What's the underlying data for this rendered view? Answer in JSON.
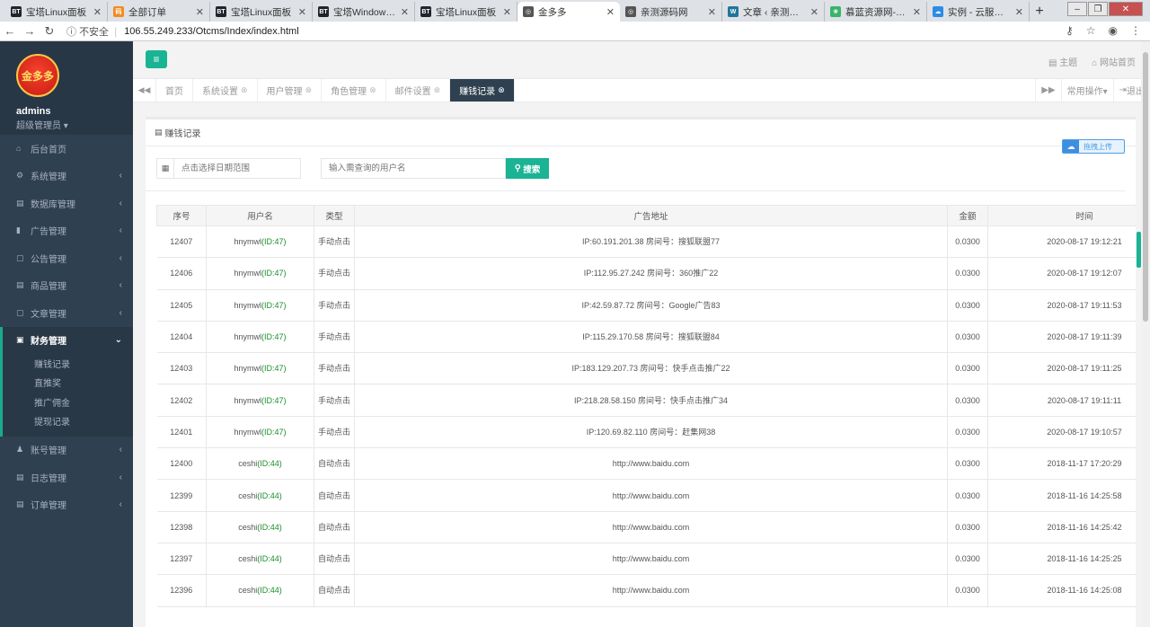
{
  "browser": {
    "tabs": [
      {
        "label": "宝塔Linux面板",
        "fav": "BT",
        "color": "#20242b"
      },
      {
        "label": "全部订单",
        "fav": "码",
        "color": "#f28b21"
      },
      {
        "label": "宝塔Linux面板",
        "fav": "BT",
        "color": "#20242b"
      },
      {
        "label": "宝塔Windows面板",
        "fav": "BT",
        "color": "#20242b"
      },
      {
        "label": "宝塔Linux面板",
        "fav": "BT",
        "color": "#20242b"
      },
      {
        "label": "金多多",
        "fav": "◎",
        "color": "#555555",
        "active": true
      },
      {
        "label": "亲测源码网",
        "fav": "◎",
        "color": "#555555"
      },
      {
        "label": "文章 ‹ 亲测源码网 —",
        "fav": "W",
        "color": "#21759b"
      },
      {
        "label": "慕蓝资源网-源码之家",
        "fav": "❀",
        "color": "#3bb36b"
      },
      {
        "label": "实例 - 云服务器 - 控",
        "fav": "☁",
        "color": "#2c8ce5"
      }
    ],
    "new_tab": "+",
    "security": "不安全",
    "url": "106.55.249.233/Otcms/Index/index.html"
  },
  "sidebar": {
    "logo_text": "金多多",
    "username": "admins",
    "role": "超级管理员 ▾",
    "menu": [
      {
        "label": "后台首页",
        "icon": "⌂",
        "arrow": ""
      },
      {
        "label": "系统管理",
        "icon": "⚙",
        "arrow": "‹"
      },
      {
        "label": "数据库管理",
        "icon": "▤",
        "arrow": "‹"
      },
      {
        "label": "广告管理",
        "icon": "▮",
        "arrow": "‹"
      },
      {
        "label": "公告管理",
        "icon": "▢",
        "arrow": "‹"
      },
      {
        "label": "商品管理",
        "icon": "▤",
        "arrow": "‹"
      },
      {
        "label": "文章管理",
        "icon": "▢",
        "arrow": "‹"
      }
    ],
    "active_menu": {
      "label": "财务管理",
      "icon": "▣",
      "arrow": "⌄"
    },
    "submenu": [
      "赚钱记录",
      "直推奖",
      "推广佣金",
      "提现记录"
    ],
    "menu_after": [
      {
        "label": "账号管理",
        "icon": "♟",
        "arrow": "‹"
      },
      {
        "label": "日志管理",
        "icon": "▤",
        "arrow": "‹"
      },
      {
        "label": "订单管理",
        "icon": "▤",
        "arrow": "‹"
      }
    ]
  },
  "header": {
    "theme": "主题",
    "site_home": "网站首页"
  },
  "page_tabs": {
    "items": [
      {
        "label": "首页",
        "closable": false
      },
      {
        "label": "系统设置",
        "closable": true
      },
      {
        "label": "用户管理",
        "closable": true
      },
      {
        "label": "角色管理",
        "closable": true
      },
      {
        "label": "邮件设置",
        "closable": true
      },
      {
        "label": "赚钱记录",
        "closable": true,
        "active": true
      }
    ],
    "common_ops": "常用操作▾",
    "logout": "退出"
  },
  "card": {
    "title": "赚钱记录",
    "upload_label": "拖拽上传",
    "date_placeholder": "点击选择日期范围",
    "user_placeholder": "输入需查询的用户名",
    "search_label": "搜索"
  },
  "table": {
    "columns": [
      "序号",
      "用户名",
      "类型",
      "广告地址",
      "金额",
      "时间"
    ],
    "rows": [
      {
        "id": "12407",
        "user": "hnymwl",
        "uid": "(ID:47)",
        "type": "手动点击",
        "ad": "IP:60.191.201.38 房间号：搜狐联盟77",
        "amount": "0.0300",
        "time": "2020-08-17 19:12:21"
      },
      {
        "id": "12406",
        "user": "hnymwl",
        "uid": "(ID:47)",
        "type": "手动点击",
        "ad": "IP:112.95.27.242 房间号：360推广22",
        "amount": "0.0300",
        "time": "2020-08-17 19:12:07"
      },
      {
        "id": "12405",
        "user": "hnymwl",
        "uid": "(ID:47)",
        "type": "手动点击",
        "ad": "IP:42.59.87.72 房间号：Google广告83",
        "amount": "0.0300",
        "time": "2020-08-17 19:11:53"
      },
      {
        "id": "12404",
        "user": "hnymwl",
        "uid": "(ID:47)",
        "type": "手动点击",
        "ad": "IP:115.29.170.58 房间号：搜狐联盟84",
        "amount": "0.0300",
        "time": "2020-08-17 19:11:39"
      },
      {
        "id": "12403",
        "user": "hnymwl",
        "uid": "(ID:47)",
        "type": "手动点击",
        "ad": "IP:183.129.207.73 房间号：快手点击推广22",
        "amount": "0.0300",
        "time": "2020-08-17 19:11:25"
      },
      {
        "id": "12402",
        "user": "hnymwl",
        "uid": "(ID:47)",
        "type": "手动点击",
        "ad": "IP:218.28.58.150 房间号：快手点击推广34",
        "amount": "0.0300",
        "time": "2020-08-17 19:11:11"
      },
      {
        "id": "12401",
        "user": "hnymwl",
        "uid": "(ID:47)",
        "type": "手动点击",
        "ad": "IP:120.69.82.110 房间号：赶集网38",
        "amount": "0.0300",
        "time": "2020-08-17 19:10:57"
      },
      {
        "id": "12400",
        "user": "ceshi",
        "uid": "(ID:44)",
        "type": "自动点击",
        "ad": "http://www.baidu.com",
        "amount": "0.0300",
        "time": "2018-11-17 17:20:29"
      },
      {
        "id": "12399",
        "user": "ceshi",
        "uid": "(ID:44)",
        "type": "自动点击",
        "ad": "http://www.baidu.com",
        "amount": "0.0300",
        "time": "2018-11-16 14:25:58"
      },
      {
        "id": "12398",
        "user": "ceshi",
        "uid": "(ID:44)",
        "type": "自动点击",
        "ad": "http://www.baidu.com",
        "amount": "0.0300",
        "time": "2018-11-16 14:25:42"
      },
      {
        "id": "12397",
        "user": "ceshi",
        "uid": "(ID:44)",
        "type": "自动点击",
        "ad": "http://www.baidu.com",
        "amount": "0.0300",
        "time": "2018-11-16 14:25:25"
      },
      {
        "id": "12396",
        "user": "ceshi",
        "uid": "(ID:44)",
        "type": "自动点击",
        "ad": "http://www.baidu.com",
        "amount": "0.0300",
        "time": "2018-11-16 14:25:08"
      }
    ]
  },
  "colors": {
    "accent": "#1ab394",
    "sidebar": "#2f4050",
    "id_text": "#1c8d2c"
  }
}
